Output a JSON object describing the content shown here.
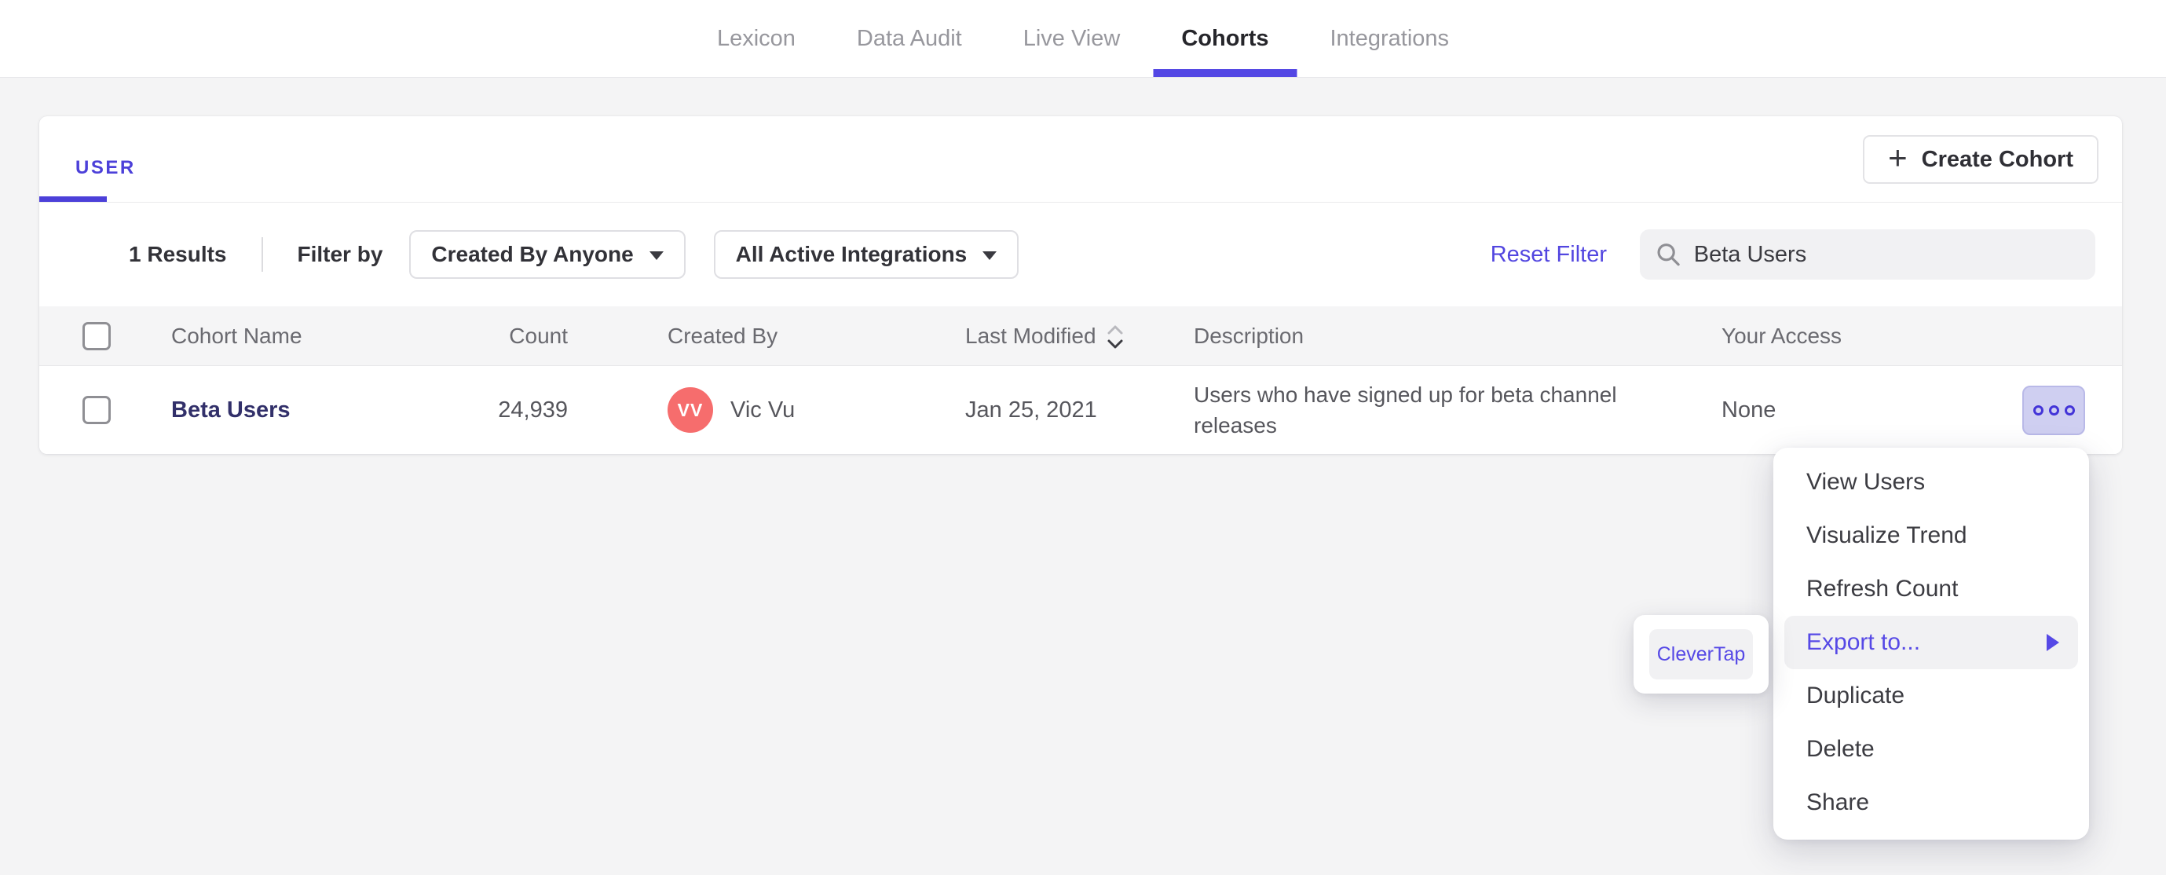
{
  "nav": {
    "tabs": [
      {
        "label": "Lexicon",
        "active": false
      },
      {
        "label": "Data Audit",
        "active": false
      },
      {
        "label": "Live View",
        "active": false
      },
      {
        "label": "Cohorts",
        "active": true
      },
      {
        "label": "Integrations",
        "active": false
      }
    ]
  },
  "card": {
    "tab_label": "USER",
    "create_button_label": "Create Cohort",
    "filters": {
      "results_count": "1 Results",
      "filter_by_label": "Filter by",
      "created_by_dropdown": "Created By Anyone",
      "integrations_dropdown": "All Active Integrations",
      "reset_filter_label": "Reset Filter",
      "search_value": "Beta Users"
    },
    "table": {
      "headers": {
        "name": "Cohort Name",
        "count": "Count",
        "created_by": "Created By",
        "last_modified": "Last Modified",
        "description": "Description",
        "access": "Your Access"
      },
      "rows": [
        {
          "name": "Beta Users",
          "count": "24,939",
          "avatar_initials": "VV",
          "created_by": "Vic Vu",
          "last_modified": "Jan 25, 2021",
          "description": "Users who have signed up for beta channel releases",
          "access": "None"
        }
      ]
    }
  },
  "context_menu": {
    "items": [
      "View Users",
      "Visualize Trend",
      "Refresh Count",
      "Export to...",
      "Duplicate",
      "Delete",
      "Share"
    ],
    "highlighted_item": "Export to..."
  },
  "export_submenu": {
    "items": [
      "CleverTap"
    ]
  },
  "icons": {
    "plus-icon": "+",
    "search-icon": "magnifier",
    "caret-down-icon": "filled-down-triangle",
    "sort-icon": "up-down-chevrons",
    "more-icon": "three-ring-dots",
    "submenu-arrow-icon": "right-triangle"
  },
  "colors": {
    "accent": "#5347e4",
    "link": "#5246e0",
    "avatar": "#f66d6d",
    "row_link": "#32306a",
    "more_button_bg": "#cfcff1",
    "menu_highlight_bg": "#f1f1f3",
    "header_bg": "#f5f5f6"
  }
}
